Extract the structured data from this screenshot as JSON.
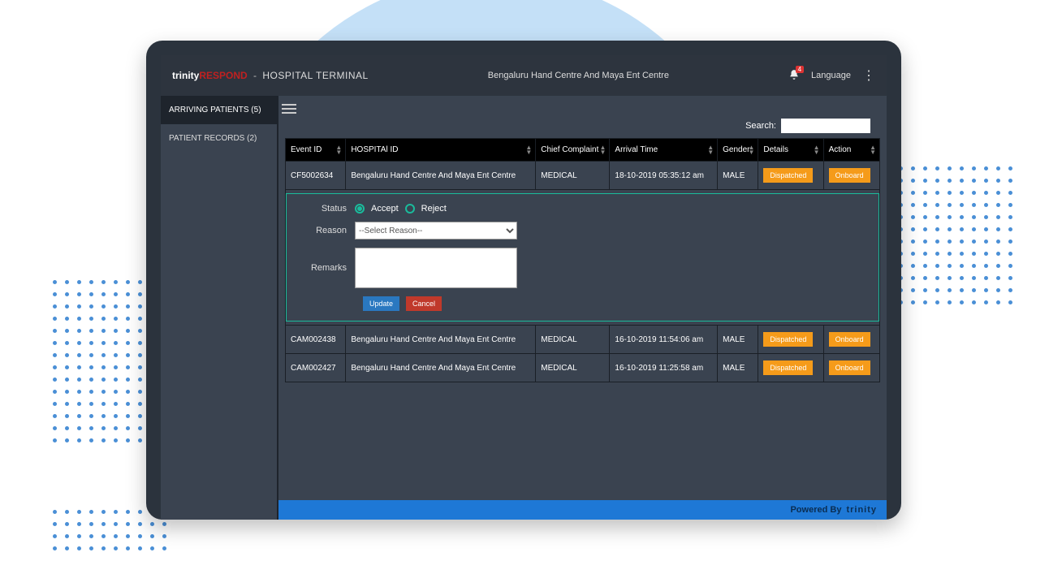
{
  "brand": {
    "trinity": "trinity",
    "respond": "RESPOND",
    "sep": "-",
    "terminal": "HOSPITAL TERMINAL"
  },
  "header": {
    "hospital": "Bengaluru Hand Centre And Maya Ent Centre",
    "language": "Language",
    "notif_count": "4"
  },
  "sidebar": {
    "arriving": "ARRIVING PATIENTS (5)",
    "records": "PATIENT RECORDS (2)"
  },
  "search": {
    "label": "Search:"
  },
  "columns": {
    "event": "Event ID",
    "hospital": "HOSPITAl ID",
    "complaint": "Chief Complaint",
    "arrival": "Arrival Time",
    "gender": "Gender",
    "details": "Details",
    "action": "Action"
  },
  "rows": [
    {
      "event": "CF5002634",
      "hospital": "Bengaluru Hand Centre And Maya Ent Centre",
      "complaint": "MEDICAL",
      "arrival": "18-10-2019 05:35:12 am",
      "gender": "MALE",
      "details": "Dispatched",
      "action": "Onboard"
    },
    {
      "event": "CAM002438",
      "hospital": "Bengaluru Hand Centre And Maya Ent Centre",
      "complaint": "MEDICAL",
      "arrival": "16-10-2019 11:54:06 am",
      "gender": "MALE",
      "details": "Dispatched",
      "action": "Onboard"
    },
    {
      "event": "CAM002427",
      "hospital": "Bengaluru Hand Centre And Maya Ent Centre",
      "complaint": "MEDICAL",
      "arrival": "16-10-2019 11:25:58 am",
      "gender": "MALE",
      "details": "Dispatched",
      "action": "Onboard"
    }
  ],
  "form": {
    "status_label": "Status",
    "accept": "Accept",
    "reject": "Reject",
    "reason_label": "Reason",
    "reason_placeholder": "--Select Reason--",
    "remarks_label": "Remarks",
    "update": "Update",
    "cancel": "Cancel"
  },
  "footer": {
    "powered": "Powered By",
    "trinity": "trinity"
  }
}
